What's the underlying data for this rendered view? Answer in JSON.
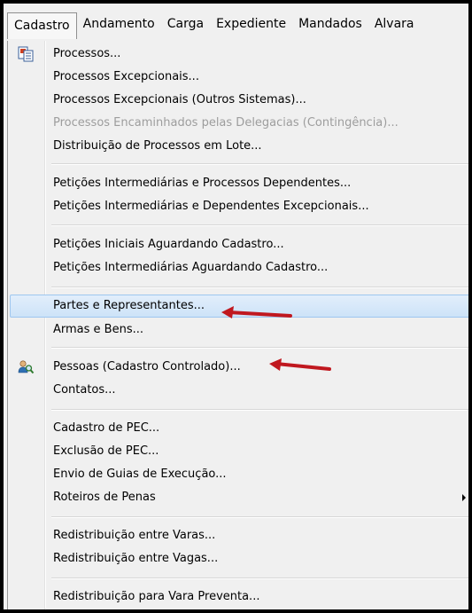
{
  "menubar": {
    "items": [
      "Cadastro",
      "Andamento",
      "Carga",
      "Expediente",
      "Mandados",
      "Alvara"
    ]
  },
  "menu": {
    "items": [
      {
        "label": "Processos...",
        "icon": "documents-icon"
      },
      {
        "label": "Processos Excepcionais..."
      },
      {
        "label": "Processos Excepcionais (Outros Sistemas)..."
      },
      {
        "label": "Processos Encaminhados pelas Delegacias (Contingência)...",
        "disabled": true
      },
      {
        "label": "Distribuição de Processos em Lote..."
      },
      {
        "label": "Petições Intermediárias e Processos Dependentes..."
      },
      {
        "label": "Petições Intermediárias e Dependentes Excepcionais..."
      },
      {
        "label": "Petições Iniciais Aguardando Cadastro..."
      },
      {
        "label": "Petições Intermediárias Aguardando Cadastro..."
      },
      {
        "label": "Partes e Representantes...",
        "selected": true
      },
      {
        "label": "Armas e Bens..."
      },
      {
        "label": "Pessoas (Cadastro Controlado)...",
        "icon": "people-search-icon"
      },
      {
        "label": "Contatos..."
      },
      {
        "label": "Cadastro de PEC..."
      },
      {
        "label": "Exclusão de PEC..."
      },
      {
        "label": "Envio de Guias de Execução..."
      },
      {
        "label": "Roteiros de Penas",
        "submenu": true
      },
      {
        "label": "Redistribuição entre Varas..."
      },
      {
        "label": "Redistribuição entre Vagas..."
      },
      {
        "label": "Redistribuição para Vara Preventa..."
      }
    ]
  },
  "annotations": {
    "arrow_color": "#c0181f"
  }
}
